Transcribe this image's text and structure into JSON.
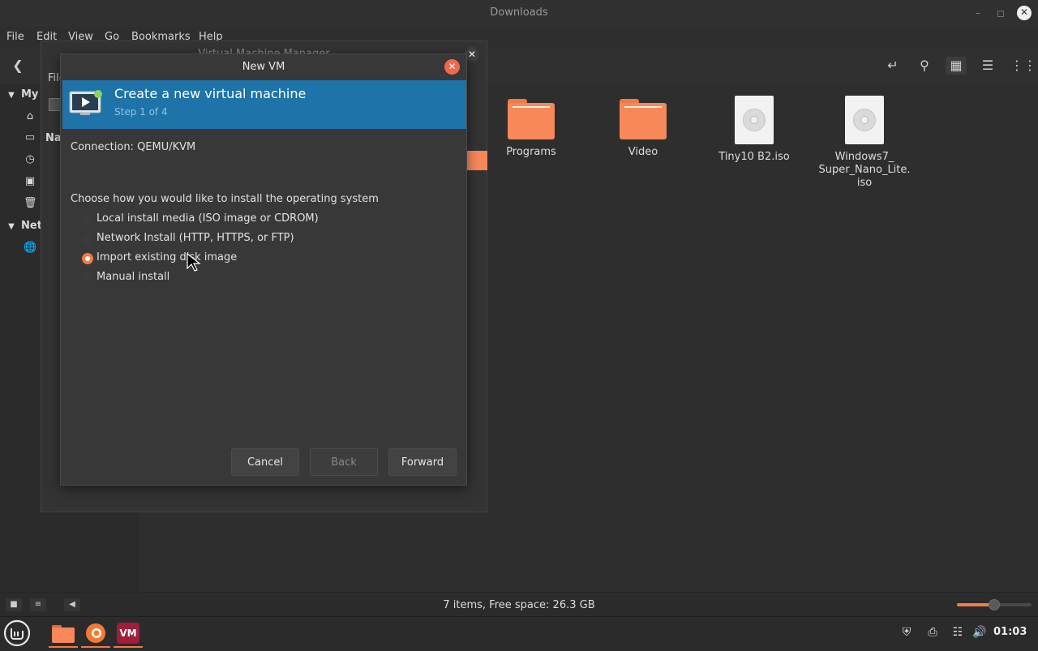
{
  "file_manager": {
    "title": "Downloads",
    "menu": [
      "File",
      "Edit",
      "View",
      "Go",
      "Bookmarks",
      "Help"
    ],
    "sidebar": {
      "my_computer_label": "My",
      "network_label": "Net"
    },
    "items": [
      {
        "label": "Programs",
        "type": "folder"
      },
      {
        "label": "Video",
        "type": "folder"
      },
      {
        "label": "Tiny10 B2.iso",
        "type": "iso"
      },
      {
        "label": "Windows7_\nSuper_Nano_Lite.\niso",
        "type": "iso"
      }
    ],
    "status": "7 items, Free space: 26.3 GB",
    "zoom_level": 0.5
  },
  "vmm": {
    "title": "Virtual Machine Manager",
    "file_menu": "File",
    "name_col": "Na"
  },
  "dialog": {
    "title": "New VM",
    "heading": "Create a new virtual machine",
    "step": "Step 1 of 4",
    "connection": "Connection:  QEMU/KVM",
    "question": "Choose how you would like to install the operating system",
    "options": [
      {
        "label": "Local install media (ISO image or CDROM)",
        "selected": false
      },
      {
        "label": "Network Install (HTTP, HTTPS, or FTP)",
        "selected": false
      },
      {
        "label": "Import existing disk image",
        "selected": true
      },
      {
        "label": "Manual install",
        "selected": false
      }
    ],
    "buttons": {
      "cancel": "Cancel",
      "back": "Back",
      "forward": "Forward"
    }
  },
  "taskbar": {
    "clock": "01:03",
    "vm_app_label": "VM"
  },
  "colors": {
    "accent": "#f27a44",
    "dialog_header": "#1e73a8",
    "close_button": "#f3684a"
  }
}
